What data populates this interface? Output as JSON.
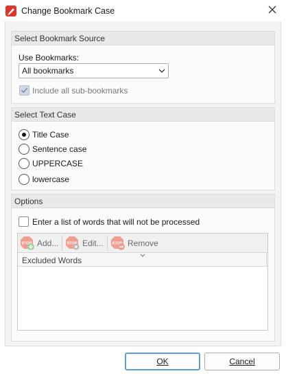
{
  "window": {
    "title": "Change Bookmark Case",
    "app_icon": "pdf-app-icon",
    "close_icon": "close-icon"
  },
  "source": {
    "header": "Select Bookmark Source",
    "use_label": "Use Bookmarks:",
    "selected": "All bookmarks",
    "include_sub": "Include all sub-bookmarks",
    "include_sub_checked": true,
    "include_sub_enabled": false
  },
  "text_case": {
    "header": "Select Text Case",
    "options": [
      "Title Case",
      "Sentence case",
      "UPPERCASE",
      "lowercase"
    ],
    "selected_index": 0
  },
  "options": {
    "header": "Options",
    "exclude_label": "Enter a list of words that will not be processed",
    "exclude_checked": false,
    "toolbar": {
      "add": "Add...",
      "edit": "Edit...",
      "remove": "Remove"
    },
    "column_header": "Excluded Words",
    "excluded_words": []
  },
  "buttons": {
    "ok": "OK",
    "cancel": "Cancel"
  },
  "colors": {
    "accent": "#5a9fd6",
    "stop_icon": "#e86a5c",
    "add_badge": "#4caf50"
  }
}
